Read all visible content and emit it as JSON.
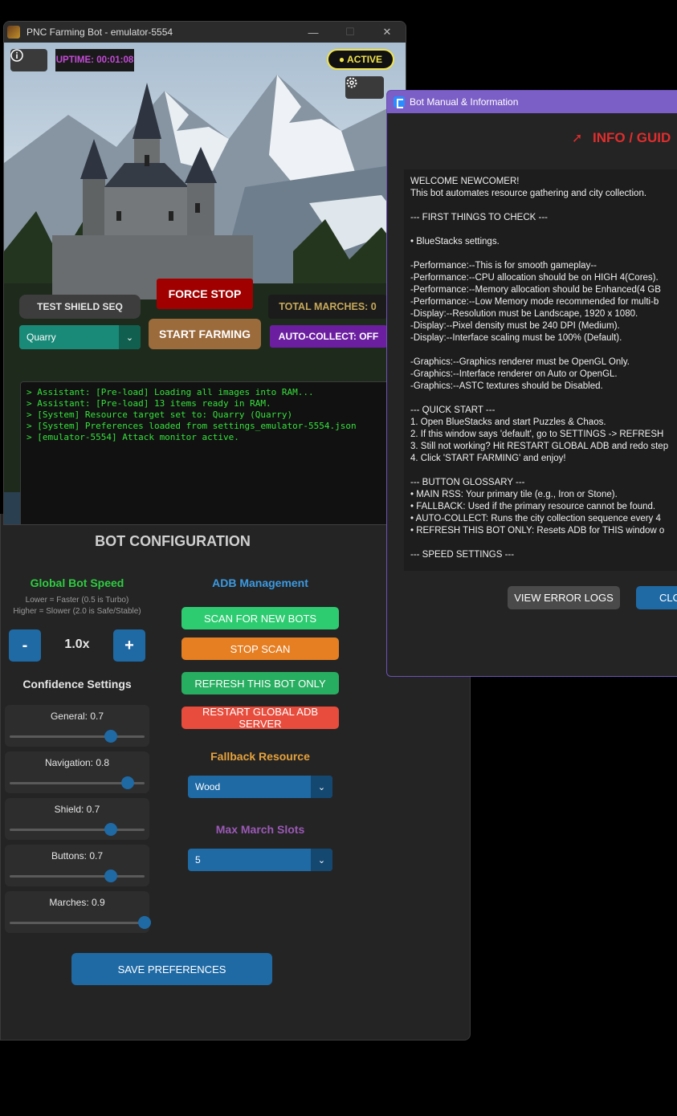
{
  "bot_window": {
    "title": "PNC Farming Bot - emulator-5554",
    "controls": [
      "—",
      "☐",
      "✕"
    ],
    "uptime": "UPTIME: 00:01:08",
    "active_badge": "● ACTIVE",
    "test_shield_label": "TEST SHIELD SEQ",
    "force_stop_label": "FORCE STOP",
    "start_farming_label": "START FARMING",
    "total_marches": "TOTAL MARCHES: 0",
    "auto_collect": "AUTO-COLLECT: OFF",
    "resource_select": "Quarry",
    "console_lines": [
      "> Assistant: [Pre-load] Loading all images into RAM...",
      "> Assistant: [Pre-load] 13 items ready in RAM.",
      "> [System] Resource target set to: Quarry (Quarry)",
      "> [System] Preferences loaded from settings_emulator-5554.json",
      "> [emulator-5554] Attack monitor active."
    ]
  },
  "config": {
    "title": "BOT CONFIGURATION",
    "speed": {
      "heading": "Global Bot Speed",
      "hint1": "Lower = Faster (0.5 is Turbo)",
      "hint2": "Higher = Slower (2.0 is Safe/Stable)",
      "minus": "-",
      "value": "1.0x",
      "plus": "+"
    },
    "confidence": {
      "heading": "Confidence Settings",
      "sliders": [
        {
          "label": "General: 0.7",
          "value": 0.7
        },
        {
          "label": "Navigation: 0.8",
          "value": 0.8
        },
        {
          "label": "Shield: 0.7",
          "value": 0.7
        },
        {
          "label": "Buttons: 0.7",
          "value": 0.7
        },
        {
          "label": "Marches: 0.9",
          "value": 0.9
        }
      ]
    },
    "adb": {
      "heading": "ADB Management",
      "scan": "SCAN FOR NEW BOTS",
      "stop_scan": "STOP SCAN",
      "refresh": "REFRESH THIS BOT ONLY",
      "restart": "RESTART GLOBAL ADB SERVER"
    },
    "fallback": {
      "heading": "Fallback Resource",
      "value": "Wood"
    },
    "max_march": {
      "heading": "Max March Slots",
      "value": "5"
    },
    "save": "SAVE PREFERENCES"
  },
  "manual": {
    "title": "Bot Manual & Information",
    "guide_heading": "INFO / GUID",
    "lines": [
      "WELCOME NEWCOMER!",
      "This bot automates resource gathering and city collection.",
      "",
      "--- FIRST THINGS TO CHECK ---",
      "",
      "• BlueStacks settings.",
      "",
      "-Performance:--This is for smooth gameplay--",
      "-Performance:--CPU allocation should be on HIGH 4(Cores).",
      "-Performance:--Memory allocation should be Enhanced(4 GB",
      "-Performance:--Low Memory mode recommended for multi-b",
      "-Display:--Resolution must be Landscape, 1920 x 1080.",
      "-Display:--Pixel density must be 240 DPI (Medium).",
      "-Display:--Interface scaling must be 100% (Default).",
      "",
      "-Graphics:--Graphics renderer must be OpenGL Only.",
      "-Graphics:--Interface renderer on Auto or OpenGL.",
      "-Graphics:--ASTC textures should be Disabled.",
      "",
      "--- QUICK START ---",
      "1. Open BlueStacks and start Puzzles & Chaos.",
      "2. If this window says 'default', go to SETTINGS -> REFRESH",
      "3. Still not working? Hit RESTART GLOBAL ADB and redo step",
      "4. Click 'START FARMING' and enjoy!",
      "",
      "--- BUTTON GLOSSARY ---",
      "• MAIN RSS: Your primary tile (e.g., Iron or Stone).",
      "• FALLBACK: Used if the primary resource cannot be found.",
      "• AUTO-COLLECT: Runs the city collection sequence every 4",
      "• REFRESH THIS BOT ONLY: Resets ADB for THIS window o",
      "",
      "--- SPEED SETTINGS ---"
    ],
    "view_logs": "VIEW ERROR LOGS",
    "close": "CLO"
  },
  "colors": {
    "accent_blue": "#1f6aa5",
    "green": "#2ecc71",
    "orange": "#e67e22",
    "red": "#e74c3c",
    "purple": "#7c5fc6",
    "force_stop": "#a00000",
    "start_farming": "#9c6b3c"
  },
  "icons": {
    "info": "info-icon",
    "settings": "gear-icon",
    "rocket": "rocket-icon"
  }
}
